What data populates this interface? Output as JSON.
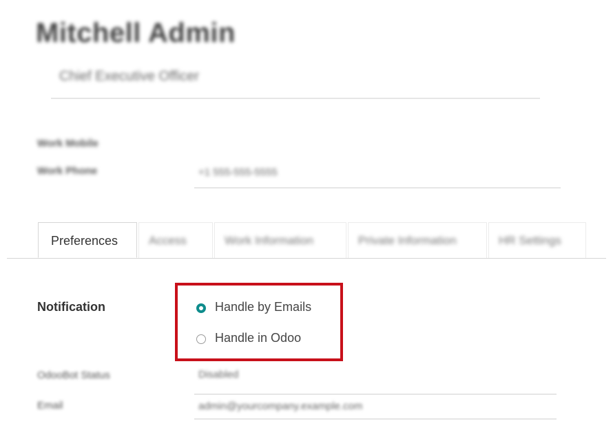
{
  "profile": {
    "name": "Mitchell Admin",
    "job_title": "Chief Executive Officer"
  },
  "contact": {
    "work_mobile_label": "Work Mobile",
    "work_phone_label": "Work Phone",
    "work_phone_value": "+1 555-555-5555"
  },
  "tabs": [
    {
      "label": "Preferences",
      "active": true
    },
    {
      "label": "Access"
    },
    {
      "label": "Work Information"
    },
    {
      "label": "Private Information"
    },
    {
      "label": "HR Settings"
    }
  ],
  "notification": {
    "label": "Notification",
    "options": [
      {
        "label": "Handle by Emails",
        "selected": true
      },
      {
        "label": "Handle in Odoo",
        "selected": false
      }
    ]
  },
  "preferences": {
    "odoobot_status_label": "OdooBot Status",
    "odoobot_status_value": "Disabled",
    "email_label": "Email",
    "email_value": "admin@yourcompany.example.com"
  },
  "colors": {
    "accent": "#0e8c8c",
    "highlight_border": "#c8101a"
  }
}
